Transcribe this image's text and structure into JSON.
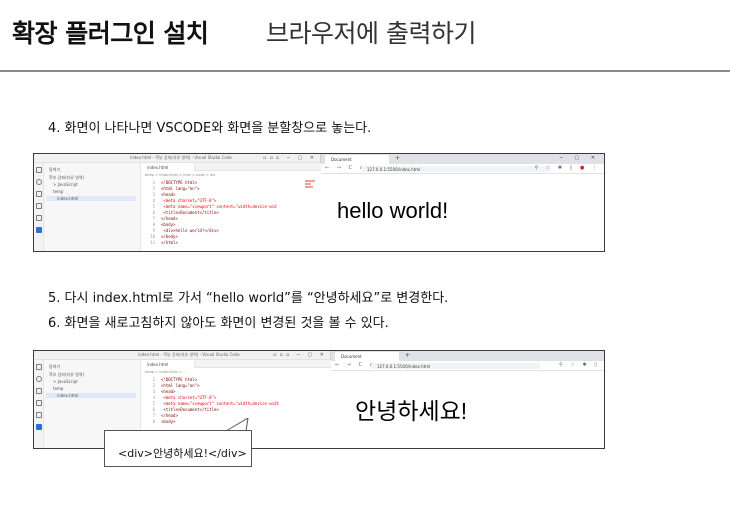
{
  "header": {
    "title": "확장 플러그인 설치",
    "subtitle": "브라우저에 출력하기"
  },
  "steps": {
    "step4": "4. 화면이 나타나면 VSCODE와 화면을 분할창으로 놓는다.",
    "step5": "5. 다시 index.html로 가서 “hello world”를 “안녕하세요”로 변경한다.",
    "step6": "6. 화면을 새로고침하지 않아도 화면이 변경된 것을 볼 수 있다."
  },
  "screenshot1": {
    "vscode": {
      "window_title": "index.html - 학부 강좌(자유 영역) - Visual Studio Code",
      "explorer_header": "탐색기",
      "explorer_items": [
        "학부 강좌(자유 영역)",
        "> JavaScript",
        "temp",
        "index.html"
      ],
      "tab_label": "index.html",
      "breadcrumb": "temp > index.html > html > body > div",
      "code_lines": [
        {
          "n": "1",
          "text": "<!DOCTYPE html>"
        },
        {
          "n": "2",
          "text": "<html lang=\"en\">"
        },
        {
          "n": "3",
          "text": "<head>"
        },
        {
          "n": "4",
          "text": "    <meta charset=\"UTF-8\">"
        },
        {
          "n": "5",
          "text": "    <meta name=\"viewport\" content=\"width=device-wid"
        },
        {
          "n": "6",
          "text": "    <title>Document</title>"
        },
        {
          "n": "7",
          "text": "</head>"
        },
        {
          "n": "8",
          "text": "<body>"
        },
        {
          "n": "9",
          "text": "    <div>hello world!</div>"
        },
        {
          "n": "10",
          "text": "</body>"
        },
        {
          "n": "11",
          "text": "</html>"
        }
      ]
    },
    "browser": {
      "tab_label": "Document",
      "url": "127.0.0.1:5500/index.html",
      "content": "hello world!"
    }
  },
  "screenshot2": {
    "vscode": {
      "window_title": "index.html - 학부 강좌(자유 영역) - Visual Studio Code",
      "explorer_header": "탐색기",
      "explorer_items": [
        "학부 강좌(자유 영역)",
        "> JavaScript",
        "temp",
        "index.html"
      ],
      "tab_label": "index.html",
      "breadcrumb": "temp > index.html > ...",
      "code_lines": [
        {
          "n": "1",
          "text": "<!DOCTYPE html>"
        },
        {
          "n": "2",
          "text": "<html lang=\"en\">"
        },
        {
          "n": "3",
          "text": "<head>"
        },
        {
          "n": "4",
          "text": "    <meta charset=\"UTF-8\">"
        },
        {
          "n": "5",
          "text": "    <meta name=\"viewport\" content=\"width=device-widt"
        },
        {
          "n": "6",
          "text": "    <title>Document</title>"
        },
        {
          "n": "7",
          "text": "</head>"
        },
        {
          "n": "8",
          "text": "<body>"
        }
      ]
    },
    "browser": {
      "tab_label": "Document",
      "url": "127.0.0.1:5500/index.html",
      "content": "안녕하세요!"
    }
  },
  "callout": {
    "text": "<div>안녕하세요!</div>"
  },
  "colors": {
    "header_line": "#8a8a8a",
    "frame_border": "#3b3b3b",
    "vscode_accent": "#2b6fd6",
    "code_tag": "#800000",
    "code_attr": "#e50000"
  }
}
